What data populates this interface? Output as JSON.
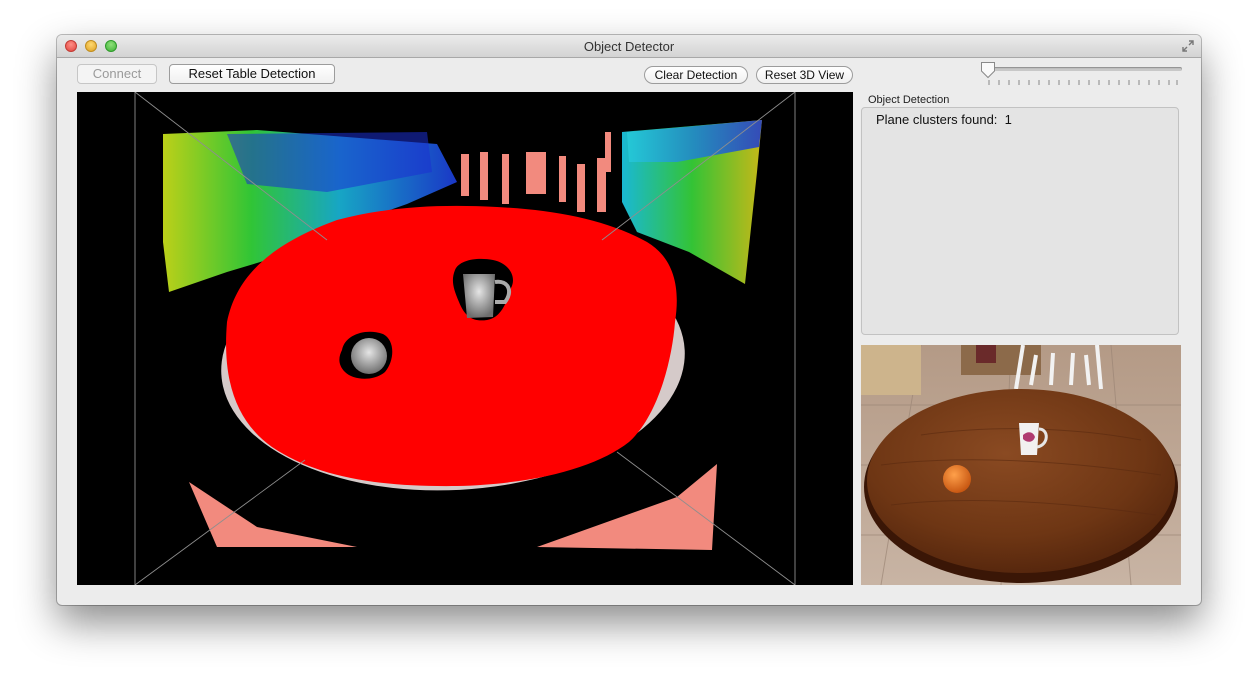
{
  "window": {
    "title": "Object Detector"
  },
  "toolbar": {
    "connect_label": "Connect",
    "reset_table_label": "Reset Table Detection",
    "clear_detection_label": "Clear Detection",
    "reset_3d_label": "Reset 3D View",
    "slider_value": 0
  },
  "detection": {
    "group_title": "Object Detection",
    "status": "Plane clusters found:  1"
  },
  "colors": {
    "plane": "#ff0000",
    "wall_points": "#f28a7e",
    "background": "#000000"
  },
  "icons": [
    "close-icon",
    "minimize-icon",
    "zoom-icon",
    "fullscreen-icon",
    "slider-thumb-icon"
  ]
}
